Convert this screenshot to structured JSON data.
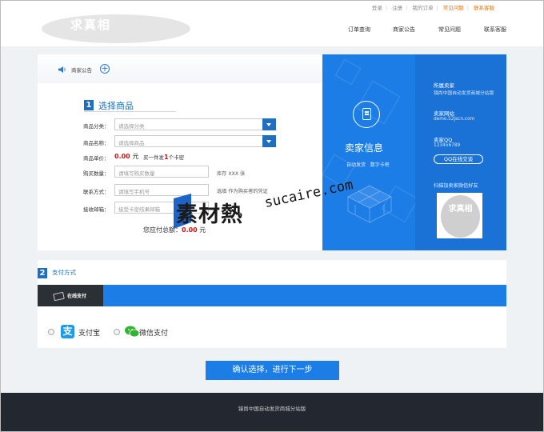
{
  "topnav": {
    "items": [
      "登录",
      "注册",
      "我的订单",
      "常见问题",
      "联系客服"
    ],
    "hot_color": "#e8760f"
  },
  "logo": {
    "text": "求真相"
  },
  "nav": [
    "订单查询",
    "商家公告",
    "常见问题",
    "联系客服"
  ],
  "notice": {
    "label": "商家公告",
    "icon": "speaker-icon"
  },
  "step1": {
    "number": "1",
    "title": "选择商品",
    "category_label": "商品分类：",
    "category_placeholder": "请选择分类",
    "product_label": "商品名称：",
    "product_placeholder": "请选择商品",
    "price_label": "商品单价：",
    "price_value": "0.00",
    "price_unit": "元",
    "price_note_pre": "买一件发",
    "price_note_num": "1",
    "price_note_post": "个卡密",
    "qty_label": "购买数量：",
    "qty_placeholder": "请填写购买数量",
    "qty_hint": "库存 XXX 张",
    "contact_label": "联系方式：",
    "contact_placeholder": "请填写手机号",
    "contact_hint": "选填 作为购买者的凭证",
    "email_label": "接收邮箱：",
    "email_placeholder": "接受卡密结果邮箱",
    "total_prefix": "您应付总额：",
    "total_value": "0.00",
    "total_unit": "元"
  },
  "seller": {
    "title": "卖家信息",
    "sub1": "自动发货",
    "sub2": "数字卡密",
    "name_label": "所属卖家",
    "name_value": "镜尚中国自动发货商城分站版",
    "site_label": "卖家网站",
    "site_value": "demo.52jscn.com",
    "qq_label": "卖家QQ",
    "qq_value": "123456789",
    "qq_button": "QQ在线交谈",
    "scan_text": "扫描加卖家微信好友",
    "qr_text": "求真相"
  },
  "step2": {
    "number": "2",
    "title": "支付方式",
    "tab_label": "在线支付",
    "alipay_label": "支付宝",
    "wechat_label": "微信支付"
  },
  "confirm": {
    "label": "确认选择，进行下一步"
  },
  "footer": {
    "text": "镜尚中国自动发货商城分站版"
  },
  "watermark": {
    "text": "素材熱",
    "url": "sucaire.com"
  },
  "colors": {
    "primary_blue": "#1d7de6",
    "step_blue": "#1f6ec0",
    "price_red": "#d01818",
    "footer_bg": "#222730"
  }
}
